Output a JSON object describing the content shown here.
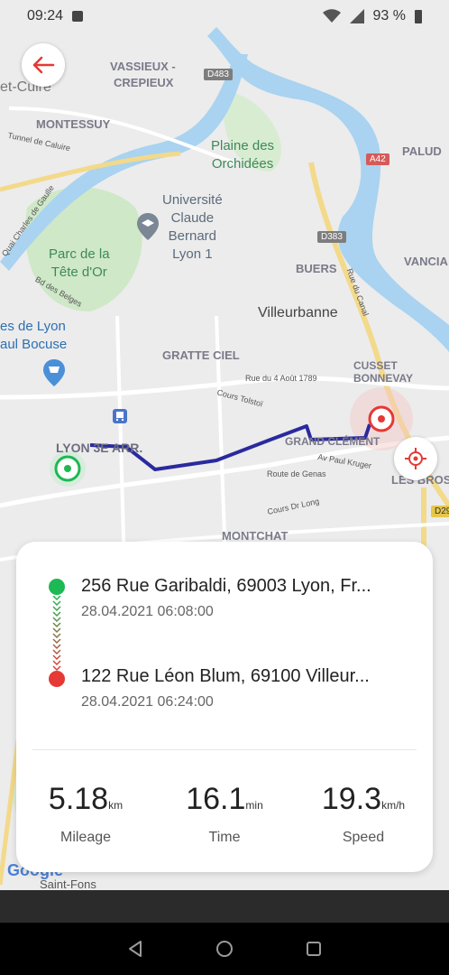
{
  "status_bar": {
    "time": "09:24",
    "battery": "93 %",
    "icons": [
      "image-icon",
      "wifi-icon",
      "signal-icon",
      "battery-icon"
    ]
  },
  "map": {
    "labels": {
      "vassieux": "VASSIEUX -",
      "crepieux": "CREPIEUX",
      "et_cuire": "et-Cuire",
      "montessuy": "MONTESSUY",
      "tunnel": "Tunnel de Caluire",
      "plaine": "Plaine des\nOrchidées",
      "palud": "PALUD",
      "universite": "Université\nClaude\nBernard\nLyon 1",
      "parc": "Parc de la\nTête d'Or",
      "buers": "BUERS",
      "vancia": "VANCIA",
      "villeurbanne": "Villeurbanne",
      "halles": "es de Lyon\naul Bocuse",
      "gratte_ciel": "GRATTE CIEL",
      "cusset": "CUSSET\nBONNEVAY",
      "lyon3": "LYON 3E ARR.",
      "grand_clement": "GRAND CLÉMENT",
      "les_brosses": "LES BROS",
      "montchat": "MONTCHAT",
      "saint_fons": "Saint-Fons",
      "rue_4_aout": "Rue du 4 Août 1789",
      "cours_tolstoi": "Cours Tolstoï",
      "route_genas": "Route de Genas",
      "av_paul_kruger": "Av Paul Kruger",
      "cours_dr_long": "Cours Dr Long",
      "quai_charles": "Quai Charles de Gaulle",
      "bd_belges": "Bd des Belges",
      "rue_canal": "Rue du Canal"
    },
    "shields": {
      "d483": "D483",
      "a42": "A42",
      "d383": "D383",
      "d29": "D29"
    },
    "route_color": "#2a2a9e",
    "start_color": "#1db954",
    "end_color": "#e53935",
    "google_logo": "Google"
  },
  "buttons": {
    "back_icon": "back-arrow-icon",
    "locate_icon": "crosshair-icon"
  },
  "trip": {
    "start": {
      "address": "256 Rue Garibaldi, 69003 Lyon, Fr...",
      "time": "28.04.2021 06:08:00"
    },
    "end": {
      "address": "122 Rue Léon Blum, 69100 Villeur...",
      "time": "28.04.2021 06:24:00"
    },
    "stats": [
      {
        "value": "5.18",
        "unit": "km",
        "label": "Mileage"
      },
      {
        "value": "16.1",
        "unit": "min",
        "label": "Time"
      },
      {
        "value": "19.3",
        "unit": "km/h",
        "label": "Speed"
      }
    ]
  },
  "nav_bar": {
    "icons": [
      "nav-back-icon",
      "nav-home-icon",
      "nav-recents-icon"
    ]
  }
}
